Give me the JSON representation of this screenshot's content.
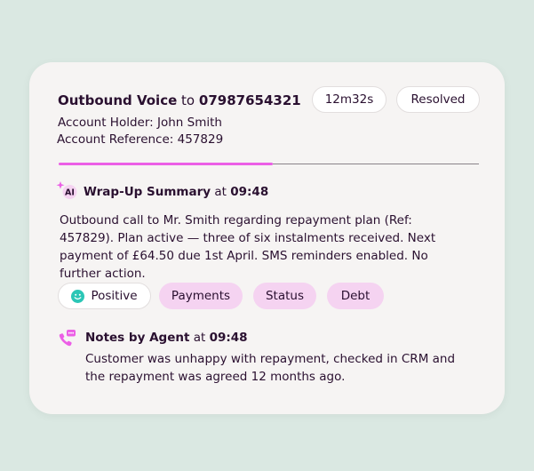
{
  "call": {
    "type_label": "Outbound Voice",
    "connector": "to",
    "phone": "07987654321",
    "duration": "12m32s",
    "status": "Resolved",
    "account_holder": "Account Holder: John Smith",
    "account_reference": "Account Reference: 457829",
    "progress_fraction": 0.51
  },
  "wrapup": {
    "icon_text": "AI",
    "title": "Wrap-Up Summary",
    "at": "at",
    "time": "09:48",
    "summary": "Outbound call to Mr. Smith regarding repayment plan (Ref: 457829). Plan active — three of six instalments received. Next payment of £64.50 due 1st April. SMS reminders enabled. No further action."
  },
  "tags": {
    "sentiment": "Positive",
    "items": [
      "Payments",
      "Status",
      "Debt"
    ]
  },
  "notes": {
    "title": "Notes by Agent",
    "at": "at",
    "time": "09:48",
    "text": "Customer was unhappy with repayment, checked in CRM and the repayment was agreed 12 months ago."
  },
  "icons": {
    "wrapup": "ai-sparkle-icon",
    "notes": "phone-chat-icon",
    "sentiment": "smiley-icon"
  },
  "colors": {
    "background": "#dae8e2",
    "card": "#f6f4f3",
    "accent": "#ec5fe6",
    "tag_background": "#f5d3f1",
    "sentiment_icon": "#2bc6b6",
    "text": "#2a1030"
  }
}
